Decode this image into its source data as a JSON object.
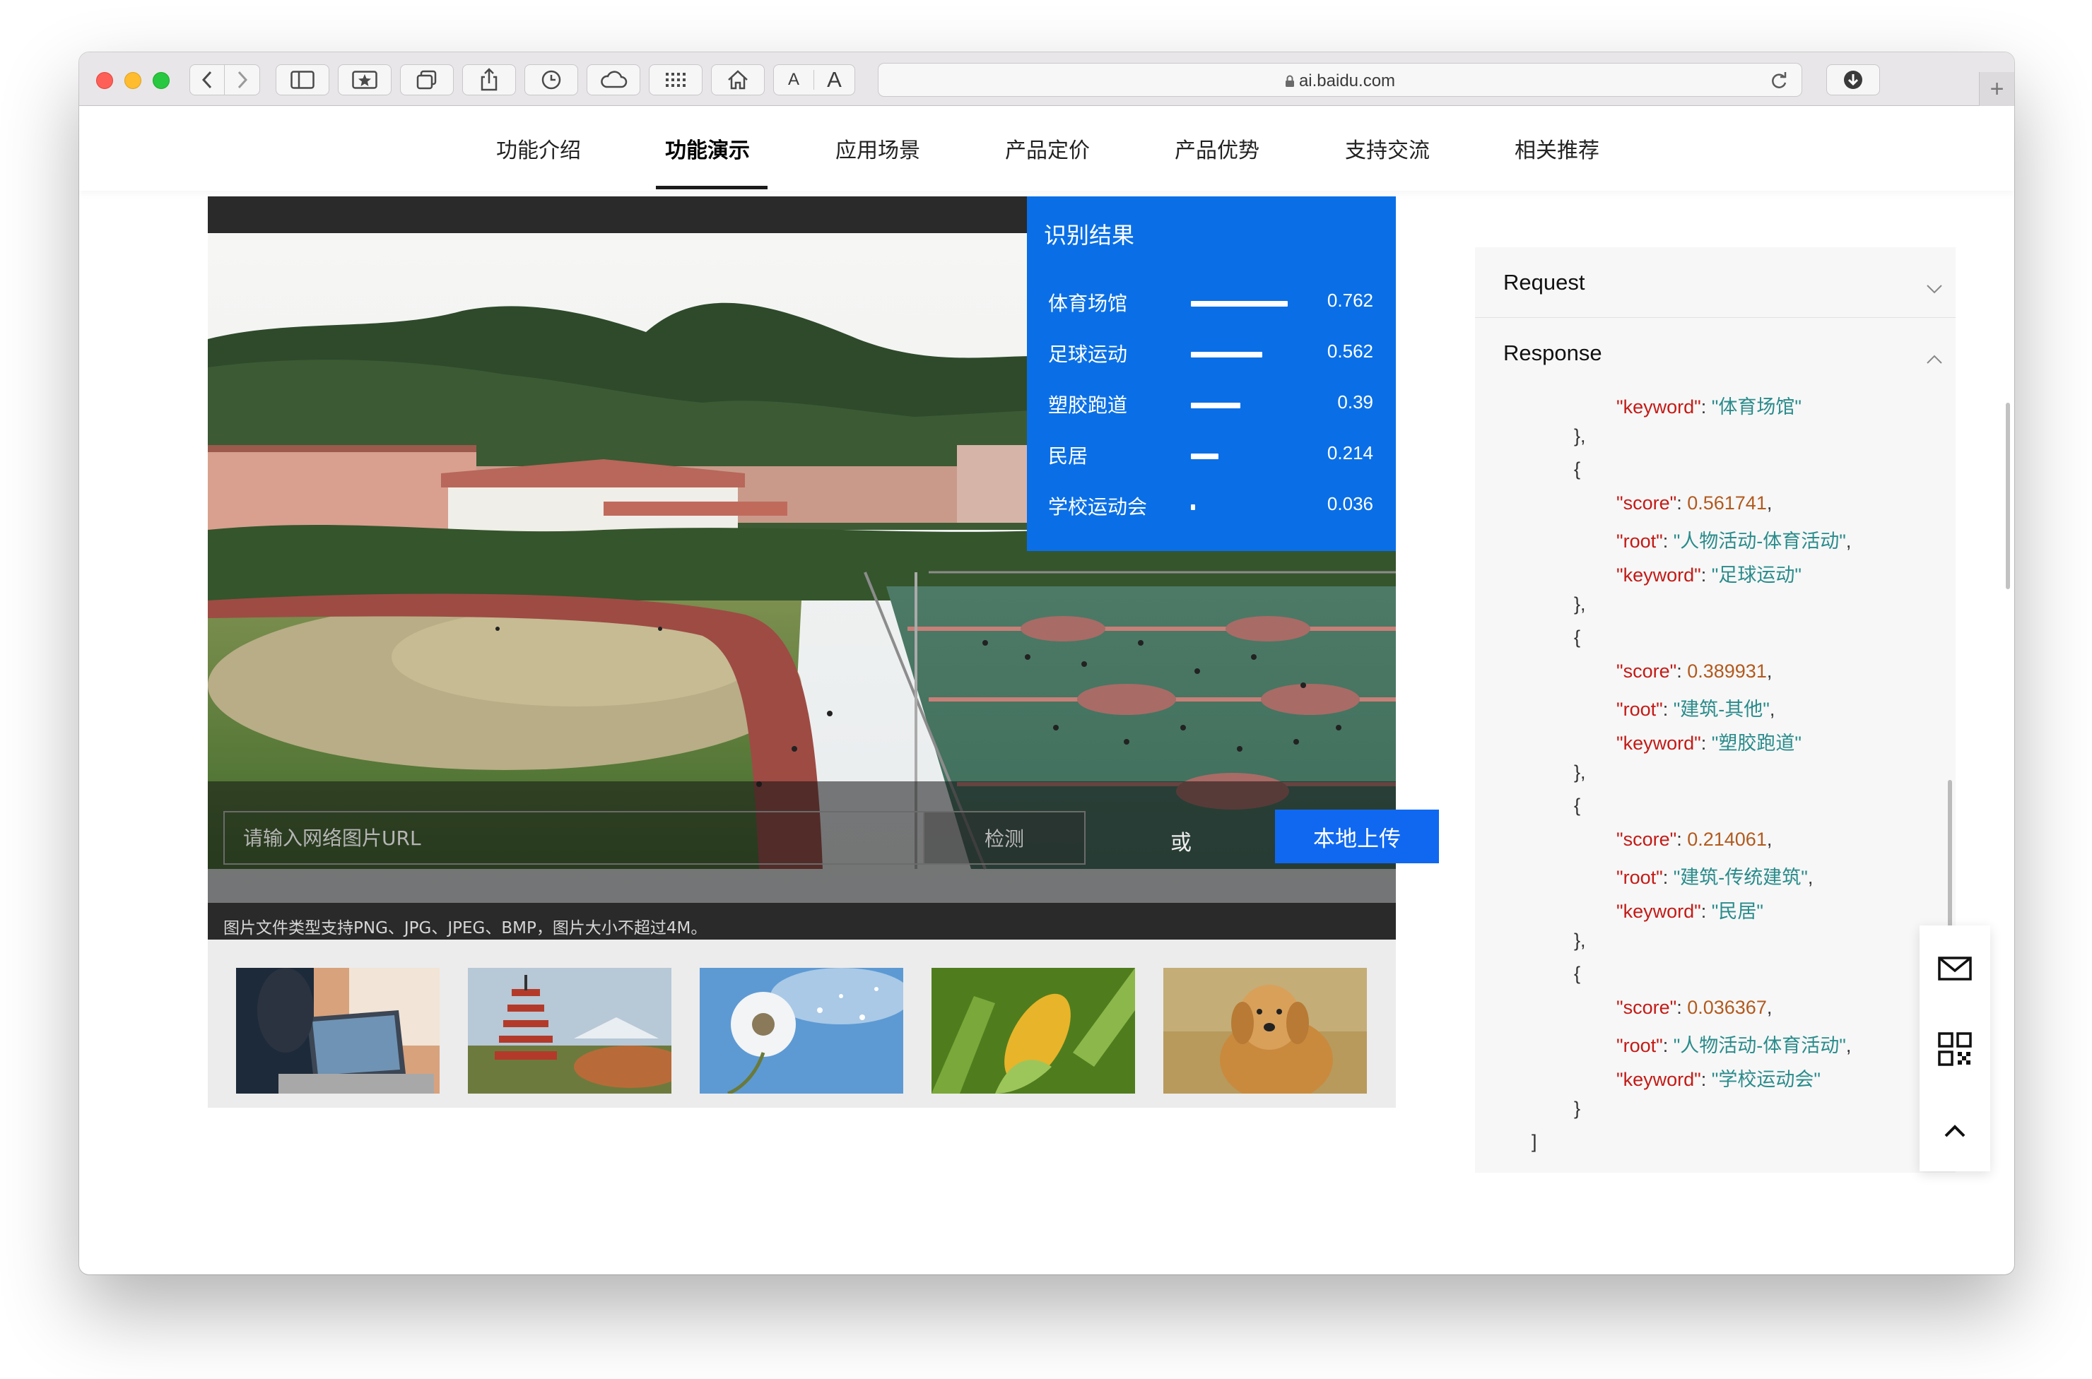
{
  "browser": {
    "url": "ai.baidu.com",
    "font_small_label": "A",
    "font_large_label": "A"
  },
  "nav": {
    "items": [
      "功能介绍",
      "功能演示",
      "应用场景",
      "产品定价",
      "产品优势",
      "支持交流",
      "相关推荐"
    ],
    "active": "功能演示"
  },
  "result": {
    "title": "识别结果",
    "rows": [
      {
        "label": "体育场馆",
        "score": "0.762",
        "value": 0.762
      },
      {
        "label": "足球运动",
        "score": "0.562",
        "value": 0.562
      },
      {
        "label": "塑胶跑道",
        "score": "0.39",
        "value": 0.39
      },
      {
        "label": "民居",
        "score": "0.214",
        "value": 0.214
      },
      {
        "label": "学校运动会",
        "score": "0.036",
        "value": 0.036
      }
    ]
  },
  "upload": {
    "url_placeholder": "请输入网络图片URL",
    "detect_label": "检测",
    "or_label": "或",
    "upload_label": "本地上传",
    "hint": "图片文件类型支持PNG、JPG、JPEG、BMP，图片大小不超过4M。"
  },
  "thumbnails": [
    "laptop",
    "pagoda",
    "dandelion",
    "corn",
    "puppy"
  ],
  "code_panel": {
    "request_label": "Request",
    "response_label": "Response",
    "lines": [
      {
        "t": "kv",
        "indent": 3,
        "key": "\"keyword\"",
        "val": "\"体育场馆\"",
        "vt": "s",
        "comma": ""
      },
      {
        "t": "p",
        "indent": 2,
        "text": "},"
      },
      {
        "t": "p",
        "indent": 2,
        "text": "{"
      },
      {
        "t": "kv",
        "indent": 3,
        "key": "\"score\"",
        "val": "0.561741",
        "vt": "n",
        "comma": ","
      },
      {
        "t": "kv",
        "indent": 3,
        "key": "\"root\"",
        "val": "\"人物活动-体育活动\"",
        "vt": "s",
        "comma": ","
      },
      {
        "t": "kv",
        "indent": 3,
        "key": "\"keyword\"",
        "val": "\"足球运动\"",
        "vt": "s",
        "comma": ""
      },
      {
        "t": "p",
        "indent": 2,
        "text": "},"
      },
      {
        "t": "p",
        "indent": 2,
        "text": "{"
      },
      {
        "t": "kv",
        "indent": 3,
        "key": "\"score\"",
        "val": "0.389931",
        "vt": "n",
        "comma": ","
      },
      {
        "t": "kv",
        "indent": 3,
        "key": "\"root\"",
        "val": "\"建筑-其他\"",
        "vt": "s",
        "comma": ","
      },
      {
        "t": "kv",
        "indent": 3,
        "key": "\"keyword\"",
        "val": "\"塑胶跑道\"",
        "vt": "s",
        "comma": ""
      },
      {
        "t": "p",
        "indent": 2,
        "text": "},"
      },
      {
        "t": "p",
        "indent": 2,
        "text": "{"
      },
      {
        "t": "kv",
        "indent": 3,
        "key": "\"score\"",
        "val": "0.214061",
        "vt": "n",
        "comma": ","
      },
      {
        "t": "kv",
        "indent": 3,
        "key": "\"root\"",
        "val": "\"建筑-传统建筑\"",
        "vt": "s",
        "comma": ","
      },
      {
        "t": "kv",
        "indent": 3,
        "key": "\"keyword\"",
        "val": "\"民居\"",
        "vt": "s",
        "comma": ""
      },
      {
        "t": "p",
        "indent": 2,
        "text": "},"
      },
      {
        "t": "p",
        "indent": 2,
        "text": "{"
      },
      {
        "t": "kv",
        "indent": 3,
        "key": "\"score\"",
        "val": "0.036367",
        "vt": "n",
        "comma": ","
      },
      {
        "t": "kv",
        "indent": 3,
        "key": "\"root\"",
        "val": "\"人物活动-体育活动\"",
        "vt": "s",
        "comma": ","
      },
      {
        "t": "kv",
        "indent": 3,
        "key": "\"keyword\"",
        "val": "\"学校运动会\"",
        "vt": "s",
        "comma": ""
      },
      {
        "t": "p",
        "indent": 2,
        "text": "}"
      },
      {
        "t": "p",
        "indent": 1,
        "text": "]"
      }
    ]
  },
  "side_tools": [
    "mail-icon",
    "qrcode-icon",
    "back-to-top-icon"
  ],
  "colors": {
    "accent_blue": "#0a6fe6",
    "upload_blue": "#1068f0",
    "json_key": "#c41a16",
    "json_string": "#2a8b8b",
    "json_number": "#b25a1e"
  }
}
